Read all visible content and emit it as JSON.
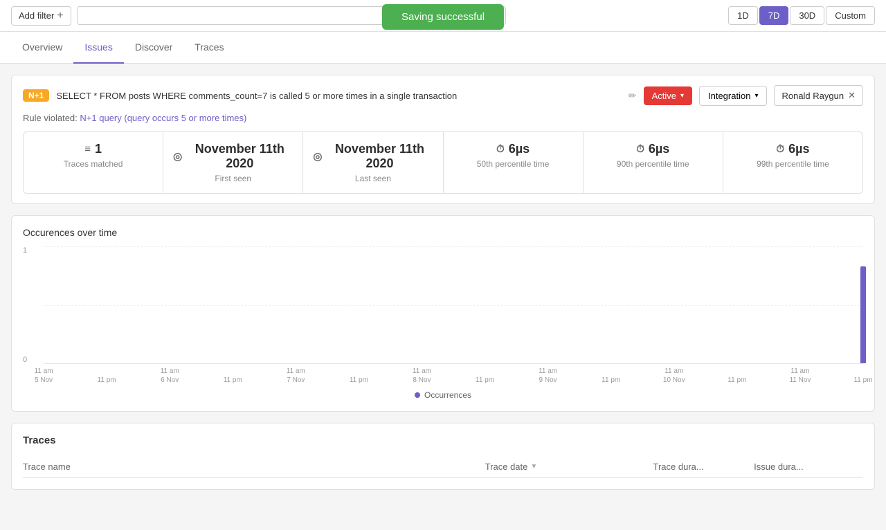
{
  "topbar": {
    "add_filter_label": "Add filter",
    "plus_icon": "+",
    "search_placeholder": "",
    "time_options": [
      "1D",
      "7D",
      "30D",
      "Custom"
    ],
    "active_time": "7D"
  },
  "toast": {
    "message": "Saving successful"
  },
  "nav": {
    "tabs": [
      "Overview",
      "Issues",
      "Discover",
      "Traces"
    ],
    "active_tab": "Issues"
  },
  "issue": {
    "badge": "N+1",
    "title": "SELECT * FROM posts WHERE comments_count=7 is called 5 or more times in a single transaction",
    "status": "Active",
    "integration_label": "Integration",
    "assignee": "Ronald Raygun",
    "rule_violated_prefix": "Rule violated:",
    "rule_link_text": "N+1 query (query occurs 5 or more times)"
  },
  "stats": [
    {
      "icon": "≡",
      "value": "1",
      "label": "Traces matched"
    },
    {
      "icon": "◎",
      "value": "November 11th 2020",
      "label": "First seen"
    },
    {
      "icon": "◎",
      "value": "November 11th 2020",
      "label": "Last seen"
    },
    {
      "icon": "⏱",
      "value": "6µs",
      "label": "50th percentile time"
    },
    {
      "icon": "⏱",
      "value": "6µs",
      "label": "90th percentile time"
    },
    {
      "icon": "⏱",
      "value": "6µs",
      "label": "99th percentile time"
    }
  ],
  "chart": {
    "title": "Occurences over time",
    "y_max": "1",
    "y_min": "0",
    "x_labels": [
      "11 am\n5 Nov",
      "11 pm",
      "11 am\n6 Nov",
      "11 pm",
      "11 am\n7 Nov",
      "11 pm",
      "11 am\n8 Nov",
      "11 pm",
      "11 am\n9 Nov",
      "11 pm",
      "11 am\n10 Nov",
      "11 pm",
      "11 am\n11 Nov",
      "11 pm"
    ],
    "legend_label": "Occurrences",
    "bar_index": 13
  },
  "traces": {
    "title": "Traces",
    "columns": [
      {
        "label": "Trace name"
      },
      {
        "label": "Trace date"
      },
      {
        "label": "Trace dura..."
      },
      {
        "label": "Issue dura..."
      }
    ]
  }
}
